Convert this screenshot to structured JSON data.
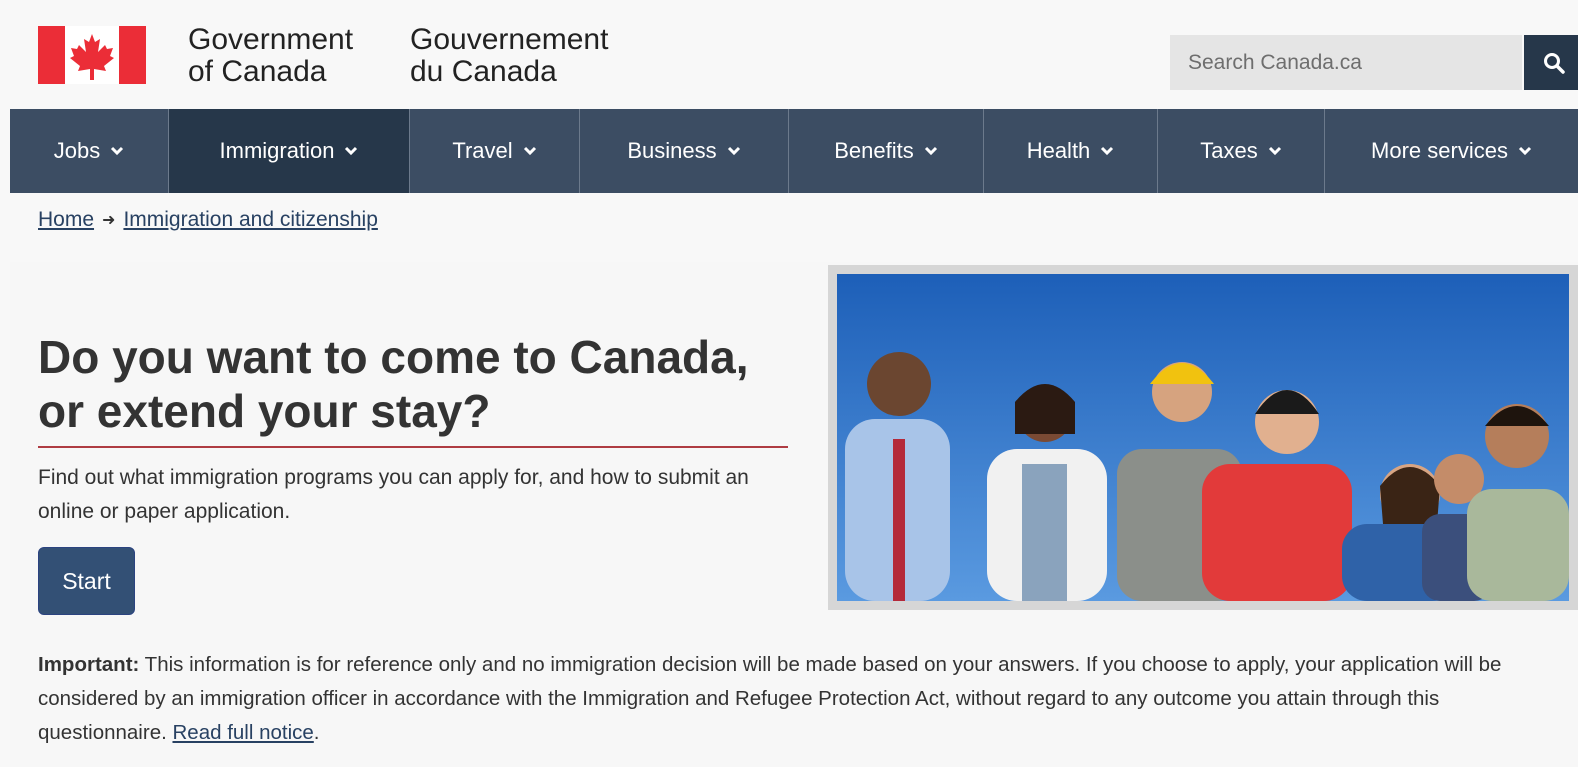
{
  "header": {
    "wordmark_en": [
      "Government",
      "of Canada"
    ],
    "wordmark_fr": [
      "Gouvernement",
      "du Canada"
    ],
    "search_placeholder": "Search Canada.ca"
  },
  "nav": {
    "items": [
      {
        "label": "Jobs"
      },
      {
        "label": "Immigration"
      },
      {
        "label": "Travel"
      },
      {
        "label": "Business"
      },
      {
        "label": "Benefits"
      },
      {
        "label": "Health"
      },
      {
        "label": "Taxes"
      },
      {
        "label": "More services"
      }
    ],
    "active": "Immigration"
  },
  "breadcrumb": {
    "home": "Home",
    "current": "Immigration and citizenship"
  },
  "main": {
    "title": "Do you want to come to Canada, or extend your stay?",
    "lead": "Find out what immigration programs you can apply for, and how to submit an online or paper application.",
    "start_label": "Start",
    "important_label": "Important:",
    "important_text": " This information is for reference only and no immigration decision will be made based on your answers. If you choose to apply, your application will be considered by an immigration officer in accordance with the Immigration and Refugee Protection Act, without regard to any outcome you attain through this questionnaire. ",
    "read_notice": "Read full notice",
    "read_notice_end": "."
  },
  "colors": {
    "flag_red": "#eb2d37",
    "nav_bg": "#3c4d63",
    "nav_active": "#26374a",
    "title_rule": "#af3c43",
    "button": "#335075",
    "link": "#284162"
  },
  "icons": {
    "search": "search-icon",
    "chevron": "chevron-down-icon",
    "breadcrumb_arrow": "arrow-right-icon"
  }
}
